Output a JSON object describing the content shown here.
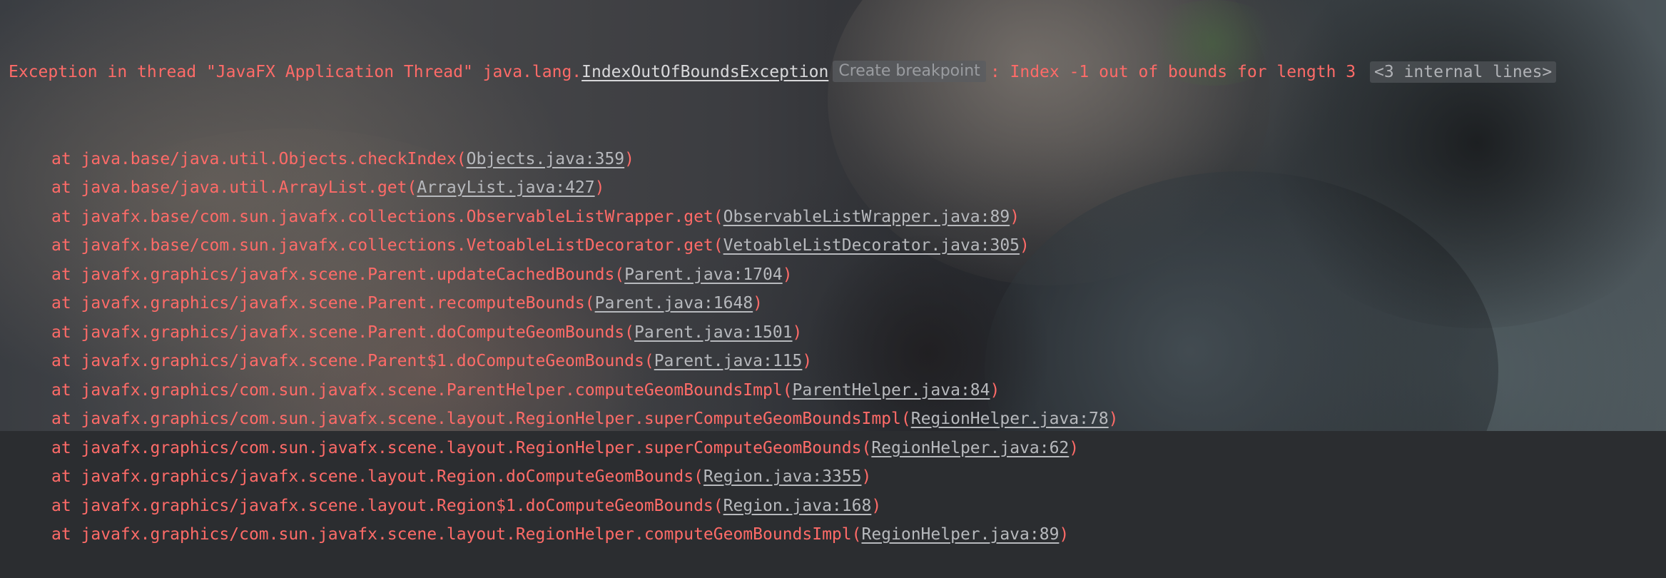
{
  "exception": {
    "prefix": "Exception in thread \"JavaFX Application Thread\" java.lang.",
    "class_link": "IndexOutOfBoundsException",
    "breakpoint_label": "Create breakpoint",
    "message": ": Index -1 out of bounds for length 3 ",
    "folded_label": "<3 internal lines>"
  },
  "frames": [
    {
      "method": "at java.base/java.util.Objects.checkIndex(",
      "source": "Objects.java:359"
    },
    {
      "method": "at java.base/java.util.ArrayList.get(",
      "source": "ArrayList.java:427"
    },
    {
      "method": "at javafx.base/com.sun.javafx.collections.ObservableListWrapper.get(",
      "source": "ObservableListWrapper.java:89"
    },
    {
      "method": "at javafx.base/com.sun.javafx.collections.VetoableListDecorator.get(",
      "source": "VetoableListDecorator.java:305"
    },
    {
      "method": "at javafx.graphics/javafx.scene.Parent.updateCachedBounds(",
      "source": "Parent.java:1704"
    },
    {
      "method": "at javafx.graphics/javafx.scene.Parent.recomputeBounds(",
      "source": "Parent.java:1648"
    },
    {
      "method": "at javafx.graphics/javafx.scene.Parent.doComputeGeomBounds(",
      "source": "Parent.java:1501"
    },
    {
      "method": "at javafx.graphics/javafx.scene.Parent$1.doComputeGeomBounds(",
      "source": "Parent.java:115"
    },
    {
      "method": "at javafx.graphics/com.sun.javafx.scene.ParentHelper.computeGeomBoundsImpl(",
      "source": "ParentHelper.java:84"
    },
    {
      "method": "at javafx.graphics/com.sun.javafx.scene.layout.RegionHelper.superComputeGeomBoundsImpl(",
      "source": "RegionHelper.java:78"
    },
    {
      "method": "at javafx.graphics/com.sun.javafx.scene.layout.RegionHelper.superComputeGeomBounds(",
      "source": "RegionHelper.java:62"
    },
    {
      "method": "at javafx.graphics/javafx.scene.layout.Region.doComputeGeomBounds(",
      "source": "Region.java:3355"
    },
    {
      "method": "at javafx.graphics/javafx.scene.layout.Region$1.doComputeGeomBounds(",
      "source": "Region.java:168"
    },
    {
      "method": "at javafx.graphics/com.sun.javafx.scene.layout.RegionHelper.computeGeomBoundsImpl(",
      "source": "RegionHelper.java:89"
    }
  ],
  "closing_paren": ")",
  "colors": {
    "error_text": "#ff6b68",
    "link_text": "#b7b9bd",
    "badge_bg": "#5a5c60"
  }
}
